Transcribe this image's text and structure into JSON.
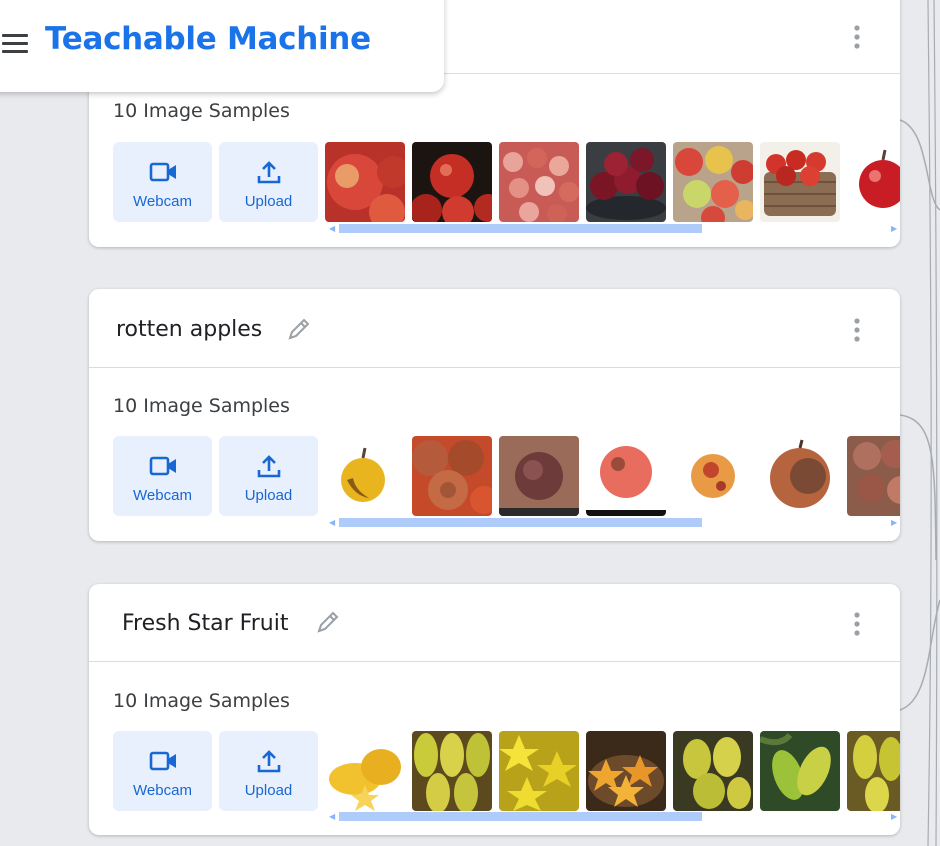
{
  "app": {
    "title": "Teachable Machine"
  },
  "classes": [
    {
      "name": "",
      "samples_label": "10 Image Samples",
      "webcam_label": "Webcam",
      "upload_label": "Upload",
      "thumbnails": [
        "apple-image",
        "apple-image",
        "apple-image",
        "apple-image",
        "apple-image",
        "apple-image",
        "apple-image"
      ]
    },
    {
      "name": "rotten apples",
      "samples_label": "10 Image Samples",
      "webcam_label": "Webcam",
      "upload_label": "Upload",
      "thumbnails": [
        "rotten-apple-image",
        "rotten-apple-image",
        "rotten-apple-image",
        "rotten-apple-image",
        "rotten-apple-image",
        "rotten-apple-image",
        "rotten-apple-image"
      ]
    },
    {
      "name": "Fresh Star Fruit",
      "samples_label": "10 Image Samples",
      "webcam_label": "Webcam",
      "upload_label": "Upload",
      "thumbnails": [
        "star-fruit-image",
        "star-fruit-image",
        "star-fruit-image",
        "star-fruit-image",
        "star-fruit-image",
        "star-fruit-image",
        "star-fruit-image"
      ]
    }
  ],
  "icons": {
    "menu": "hamburger-menu-icon",
    "edit": "pencil-icon",
    "options": "more-vert-icon",
    "webcam": "videocam-icon",
    "upload": "upload-icon"
  },
  "colors": {
    "brand": "#1a73e8",
    "button_bg": "#e8f0fe",
    "button_text": "#1967d2",
    "scrollbar": "#aecbfa",
    "background": "#e8eaed"
  }
}
